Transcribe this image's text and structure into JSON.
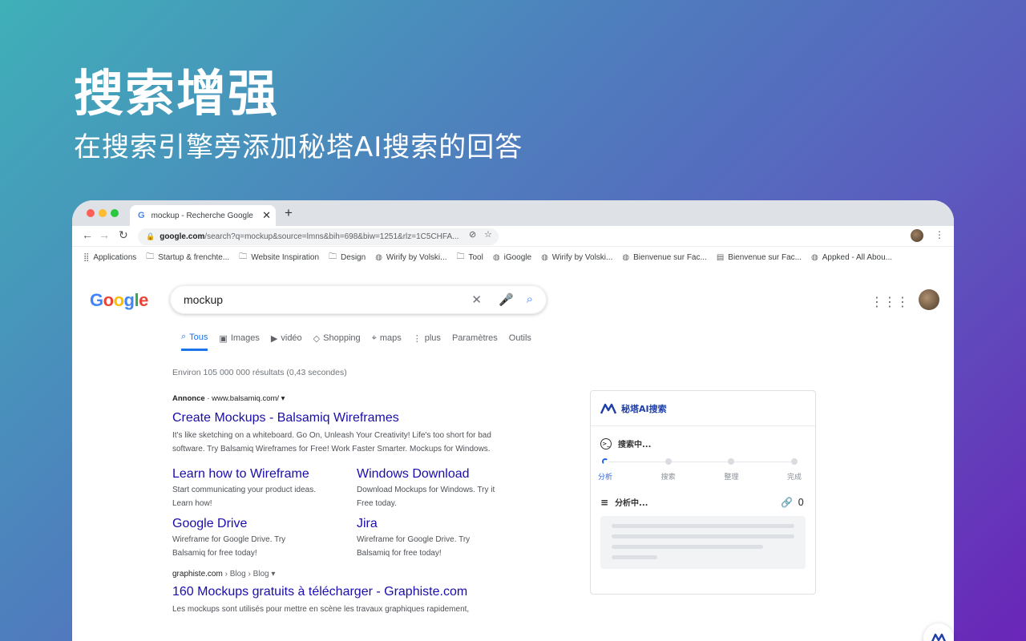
{
  "hero": {
    "title": "搜索增强",
    "subtitle": "在搜索引擎旁添加秘塔AI搜索的回答"
  },
  "browser": {
    "tab_title": "mockup - Recherche Google",
    "tab_favicon": "G",
    "address": {
      "host": "google.com",
      "path": "/search?q=mockup&source=lmns&bih=698&biw=1251&rlz=1C5CHFA..."
    },
    "bookmarks": [
      {
        "icon": "apps-icon",
        "label": "Applications"
      },
      {
        "icon": "folder-icon",
        "label": "Startup & frenchte..."
      },
      {
        "icon": "folder-icon",
        "label": "Website Inspiration"
      },
      {
        "icon": "folder-icon",
        "label": "Design"
      },
      {
        "icon": "globe-icon",
        "label": "Wirify by Volski..."
      },
      {
        "icon": "folder-icon",
        "label": "Tool"
      },
      {
        "icon": "globe-icon",
        "label": "iGoogle"
      },
      {
        "icon": "globe-icon",
        "label": "Wirify by Volski..."
      },
      {
        "icon": "globe-icon",
        "label": "Bienvenue sur Fac..."
      },
      {
        "icon": "page-icon",
        "label": "Bienvenue sur Fac..."
      },
      {
        "icon": "globe-icon",
        "label": "Appked - All Abou..."
      }
    ]
  },
  "google": {
    "logo": "Google",
    "query": "mockup",
    "tabs": [
      {
        "icon": "search-icon",
        "label": "Tous",
        "active": true
      },
      {
        "icon": "image-icon",
        "label": "Images"
      },
      {
        "icon": "video-icon",
        "label": "vidéo"
      },
      {
        "icon": "tag-icon",
        "label": "Shopping"
      },
      {
        "icon": "pin-icon",
        "label": "maps"
      },
      {
        "icon": "more-icon",
        "label": "plus"
      },
      {
        "icon": "",
        "label": "Paramètres"
      },
      {
        "icon": "",
        "label": "Outils"
      }
    ],
    "stats": "Environ 105 000 000 résultats (0,43 secondes)",
    "ad": {
      "badge": "Annonce",
      "url": "www.balsamiq.com/",
      "title": "Create Mockups - Balsamiq Wireframes",
      "desc": "It's like sketching on a whiteboard. Go On, Unleash Your Creativity! Life's too short for bad software. Try Balsamiq Wireframes for Free! Work Faster Smarter. Mockups for Windows.",
      "sitelinks": [
        {
          "title": "Learn how to Wireframe",
          "desc": "Start communicating your product ideas. Learn how!"
        },
        {
          "title": "Windows Download",
          "desc": "Download Mockups for Windows. Try it Free today."
        },
        {
          "title": "Google Drive",
          "desc": "Wireframe for Google Drive. Try Balsamiq for free today!"
        },
        {
          "title": "Jira",
          "desc": "Wireframe for Google Drive. Try Balsamiq for free today!"
        }
      ]
    },
    "organic": {
      "host": "graphiste.com",
      "crumbs": " › Blog › Blog ▾",
      "title": "160 Mockups gratuits à télécharger - Graphiste.com",
      "desc": "Les mockups sont utilisés pour mettre en scène les travaux graphiques rapidement,"
    }
  },
  "ai_panel": {
    "brand": "秘塔AI搜索",
    "status": "搜索中...",
    "steps": [
      "分析",
      "搜索",
      "整理",
      "完成"
    ],
    "active_step": 0,
    "analyzing": "分析中...",
    "link_count": "0",
    "accent": "#2563eb"
  }
}
